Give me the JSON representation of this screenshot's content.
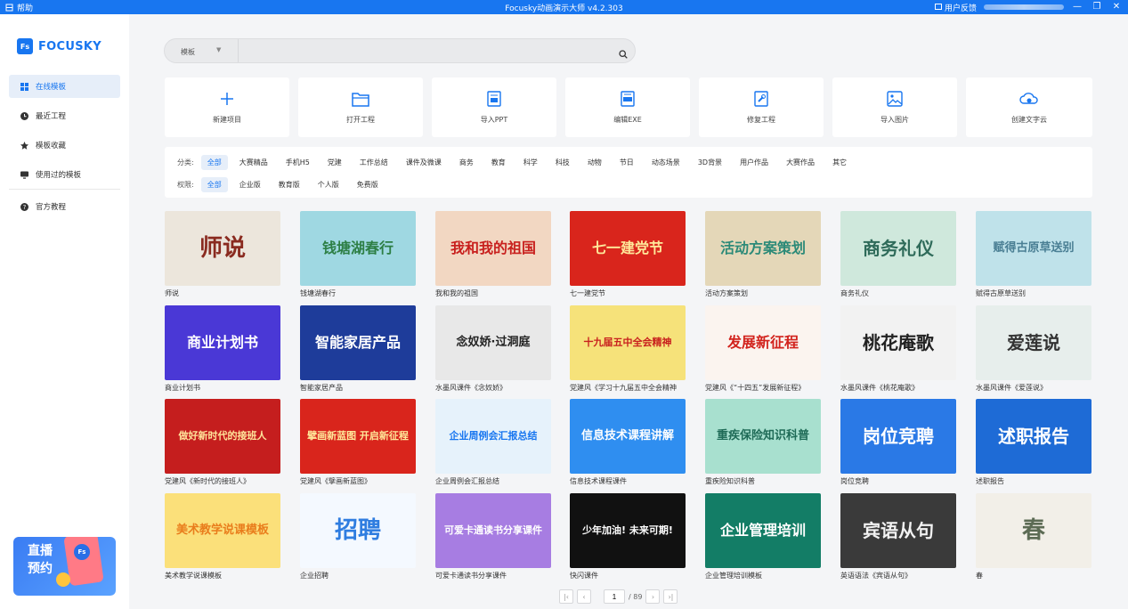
{
  "titlebar": {
    "help": "帮助",
    "title": "Focusky动画演示大师 v4.2.303",
    "feedback": "用户反馈"
  },
  "logo": {
    "badge": "Fs",
    "name": "FOCUSKY"
  },
  "sidebar": {
    "items": [
      {
        "label": "在线模板",
        "icon": "grid-icon",
        "active": true
      },
      {
        "label": "最近工程",
        "icon": "clock-icon"
      },
      {
        "label": "模板收藏",
        "icon": "star-icon"
      },
      {
        "label": "使用过的模板",
        "icon": "monitor-icon"
      },
      {
        "label": "官方教程",
        "icon": "help-circle-icon"
      }
    ],
    "promo": {
      "text": "直播预约",
      "badge": "Fs"
    }
  },
  "search": {
    "type_label": "模板",
    "placeholder": ""
  },
  "actions": [
    {
      "label": "新建项目",
      "icon": "plus-icon"
    },
    {
      "label": "打开工程",
      "icon": "folder-icon"
    },
    {
      "label": "导入PPT",
      "icon": "ppt-icon"
    },
    {
      "label": "编辑EXE",
      "icon": "exe-icon"
    },
    {
      "label": "修复工程",
      "icon": "repair-icon"
    },
    {
      "label": "导入图片",
      "icon": "image-icon"
    },
    {
      "label": "创建文字云",
      "icon": "cloud-icon"
    }
  ],
  "filters": {
    "category_label": "分类:",
    "categories": [
      "全部",
      "大赛精品",
      "手机H5",
      "党建",
      "工作总结",
      "课件及微课",
      "商务",
      "教育",
      "科学",
      "科技",
      "动物",
      "节日",
      "动态场景",
      "3D背景",
      "用户作品",
      "大赛作品",
      "其它"
    ],
    "permission_label": "权限:",
    "permissions": [
      "全部",
      "企业版",
      "教育版",
      "个人版",
      "免费版"
    ]
  },
  "templates": [
    {
      "caption": "师说",
      "thumb_text": "师说",
      "bg": "#ece6dc",
      "fg": "#8a2b20"
    },
    {
      "caption": "钱塘湖春行",
      "thumb_text": "钱塘湖春行",
      "bg": "#9fd8e2",
      "fg": "#2d7f45"
    },
    {
      "caption": "我和我的祖国",
      "thumb_text": "我和我的祖国",
      "bg": "#f2d7c2",
      "fg": "#c8201e"
    },
    {
      "caption": "七一建党节",
      "thumb_text": "七一建党节",
      "bg": "#d9251c",
      "fg": "#ffe89a"
    },
    {
      "caption": "活动方案策划",
      "thumb_text": "活动方案策划",
      "bg": "#e4d7b8",
      "fg": "#2c8a78"
    },
    {
      "caption": "商务礼仪",
      "thumb_text": "商务礼仪",
      "bg": "#cfe8dc",
      "fg": "#2f6b5a"
    },
    {
      "caption": "赋得古原草送别",
      "thumb_text": "赋得古原草送别",
      "bg": "#bfe2ea",
      "fg": "#4a7f94"
    },
    {
      "caption": "商业计划书",
      "thumb_text": "商业计划书",
      "bg": "#4a38d6",
      "fg": "#ffffff"
    },
    {
      "caption": "智能家居产品",
      "thumb_text": "智能家居产品",
      "bg": "#1e3c9a",
      "fg": "#ffffff"
    },
    {
      "caption": "水墨风课件《念奴娇》",
      "thumb_text": "念奴娇·过洞庭",
      "bg": "#e8e8e8",
      "fg": "#222222"
    },
    {
      "caption": "党建风《学习十九届五中全会精神",
      "thumb_text": "十九届五中全会精神",
      "bg": "#f6e27a",
      "fg": "#c8201e"
    },
    {
      "caption": "党建风《“十四五”发展新征程》",
      "thumb_text": "发展新征程",
      "bg": "#fbf4ef",
      "fg": "#d2231d"
    },
    {
      "caption": "水墨风课件《桃花庵歌》",
      "thumb_text": "桃花庵歌",
      "bg": "#f2f2f2",
      "fg": "#222222"
    },
    {
      "caption": "水墨风课件《爱莲说》",
      "thumb_text": "爱莲说",
      "bg": "#e7eeec",
      "fg": "#333333"
    },
    {
      "caption": "党建风《新时代的接班人》",
      "thumb_text": "做好新时代的接班人",
      "bg": "#c51e1e",
      "fg": "#ffe39a"
    },
    {
      "caption": "党建风《擘画新蓝图》",
      "thumb_text": "擘画新蓝图 开启新征程",
      "bg": "#d9251c",
      "fg": "#ffe89a"
    },
    {
      "caption": "企业周例会汇报总结",
      "thumb_text": "企业周例会汇报总结",
      "bg": "#e6f2fb",
      "fg": "#1876f0"
    },
    {
      "caption": "信息技术课程课件",
      "thumb_text": "信息技术课程讲解",
      "bg": "#2f8ef0",
      "fg": "#ffffff"
    },
    {
      "caption": "重疾险知识科普",
      "thumb_text": "重疾保险知识科普",
      "bg": "#a8e0cf",
      "fg": "#1f6b57"
    },
    {
      "caption": "岗位竞聘",
      "thumb_text": "岗位竞聘",
      "bg": "#2a79e6",
      "fg": "#ffffff"
    },
    {
      "caption": "述职报告",
      "thumb_text": "述职报告",
      "bg": "#1e6bd6",
      "fg": "#ffffff"
    },
    {
      "caption": "美术教学说课模板",
      "thumb_text": "美术教学说课模板",
      "bg": "#fbe07a",
      "fg": "#e97d1c"
    },
    {
      "caption": "企业招聘",
      "thumb_text": "招聘",
      "bg": "#f4f9ff",
      "fg": "#2f7de0"
    },
    {
      "caption": "可爱卡通读书分享课件",
      "thumb_text": "可爱卡通读书分享课件",
      "bg": "#a77de2",
      "fg": "#ffffff"
    },
    {
      "caption": "快闪课件",
      "thumb_text": "少年加油! 未来可期!",
      "bg": "#111111",
      "fg": "#ffffff"
    },
    {
      "caption": "企业管理培训模板",
      "thumb_text": "企业管理培训",
      "bg": "#137d66",
      "fg": "#ffffff"
    },
    {
      "caption": "英语语法《宾语从句》",
      "thumb_text": "宾语从句",
      "bg": "#3a3a3a",
      "fg": "#f2f2f2"
    },
    {
      "caption": "春",
      "thumb_text": "春",
      "bg": "#f2efe8",
      "fg": "#5c6b54"
    }
  ],
  "pager": {
    "current": "1",
    "total": "/ 89"
  }
}
